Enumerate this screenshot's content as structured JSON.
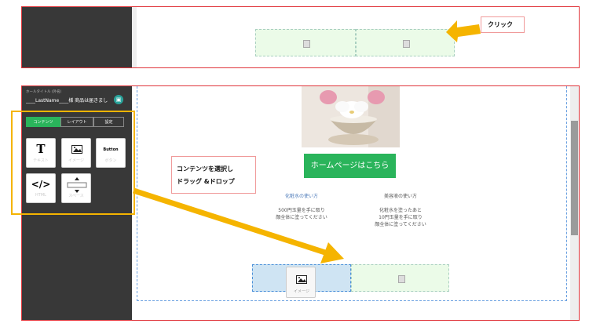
{
  "top_callout": {
    "text": "クリック"
  },
  "sidebar": {
    "title_small": "ホールタイトル (外名)",
    "title_main": "____LastName____様 商品は届きまし",
    "tabs": [
      "コンテンツ",
      "レイアウト",
      "設定"
    ],
    "tiles": [
      {
        "icon": "T",
        "label": "テキスト"
      },
      {
        "icon": "image",
        "label": "イメージ"
      },
      {
        "icon": "Button",
        "label": "ボタン"
      },
      {
        "icon": "</>",
        "label": "HTML"
      },
      {
        "icon": "spacer",
        "label": "スペース"
      }
    ]
  },
  "instruction_callout": {
    "line1": "コンテンツを選択し",
    "line2": "ドラッグ &ドロップ"
  },
  "email": {
    "cta_button": "ホームページはこちら",
    "col1": {
      "heading": "化粧水の使い方",
      "body": [
        "500円玉量を手に取り",
        "顔全体に塗ってください"
      ]
    },
    "col2": {
      "heading": "美容液の使い方",
      "body": [
        "化粧水を塗ったあと",
        "10円玉量を手に取り",
        "顔全体に塗ってください"
      ]
    },
    "drop_label": "イメージ"
  },
  "colors": {
    "accent_green": "#2ab45b",
    "arrow": "#f5b400",
    "frame_red": "#e0343a"
  }
}
